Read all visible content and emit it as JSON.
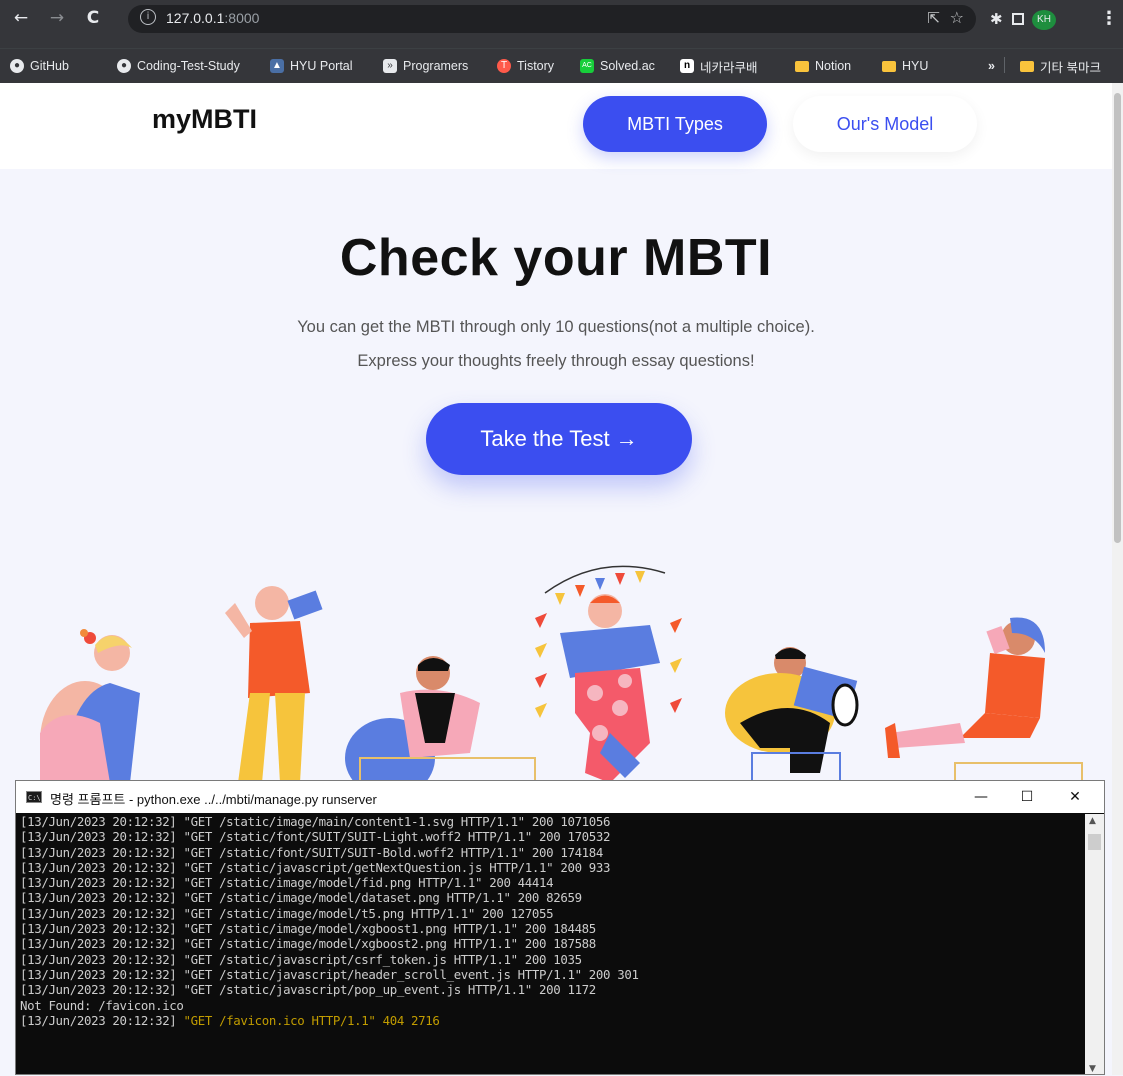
{
  "browser": {
    "host": "127.0.0.1",
    "port": ":8000",
    "profile_initials": "KH",
    "bookmarks": [
      {
        "label": "GitHub"
      },
      {
        "label": "Coding-Test-Study"
      },
      {
        "label": "HYU Portal"
      },
      {
        "label": "Programers"
      },
      {
        "label": "Tistory"
      },
      {
        "label": "Solved.ac"
      },
      {
        "label": "네카라쿠배"
      },
      {
        "label": "Notion"
      },
      {
        "label": "HYU"
      }
    ],
    "overflow": "»",
    "other_bookmarks": "기타 북마크"
  },
  "site": {
    "logo": "myMBTI",
    "nav": {
      "types": "MBTI Types",
      "model": "Our's Model"
    },
    "hero": {
      "title": "Check your MBTI",
      "sub1": "You can get the MBTI through only 10 questions(not a multiple choice).",
      "sub2": "Express your thoughts freely through essay questions!",
      "cta": "Take the Test →"
    },
    "colors": {
      "accent": "#3b4ef0",
      "background": "#f4f5fd"
    }
  },
  "terminal": {
    "title": "명령 프롬프트 - python.exe  ../../mbti/manage.py runserver",
    "lines": [
      "[13/Jun/2023 20:12:32] \"GET /static/image/main/content1-1.svg HTTP/1.1\" 200 1071056",
      "[13/Jun/2023 20:12:32] \"GET /static/font/SUIT/SUIT-Light.woff2 HTTP/1.1\" 200 170532",
      "[13/Jun/2023 20:12:32] \"GET /static/font/SUIT/SUIT-Bold.woff2 HTTP/1.1\" 200 174184",
      "[13/Jun/2023 20:12:32] \"GET /static/javascript/getNextQuestion.js HTTP/1.1\" 200 933",
      "[13/Jun/2023 20:12:32] \"GET /static/image/model/fid.png HTTP/1.1\" 200 44414",
      "[13/Jun/2023 20:12:32] \"GET /static/image/model/dataset.png HTTP/1.1\" 200 82659",
      "[13/Jun/2023 20:12:32] \"GET /static/image/model/t5.png HTTP/1.1\" 200 127055",
      "[13/Jun/2023 20:12:32] \"GET /static/image/model/xgboost1.png HTTP/1.1\" 200 184485",
      "[13/Jun/2023 20:12:32] \"GET /static/image/model/xgboost2.png HTTP/1.1\" 200 187588",
      "[13/Jun/2023 20:12:32] \"GET /static/javascript/csrf_token.js HTTP/1.1\" 200 1035",
      "[13/Jun/2023 20:12:32] \"GET /static/javascript/header_scroll_event.js HTTP/1.1\" 200 301",
      "[13/Jun/2023 20:12:32] \"GET /static/javascript/pop_up_event.js HTTP/1.1\" 200 1172",
      "Not Found: /favicon.ico"
    ],
    "last_prefix": "[13/Jun/2023 20:12:32] ",
    "last_warn": "\"GET /favicon.ico HTTP/1.1\" 404 2716"
  }
}
